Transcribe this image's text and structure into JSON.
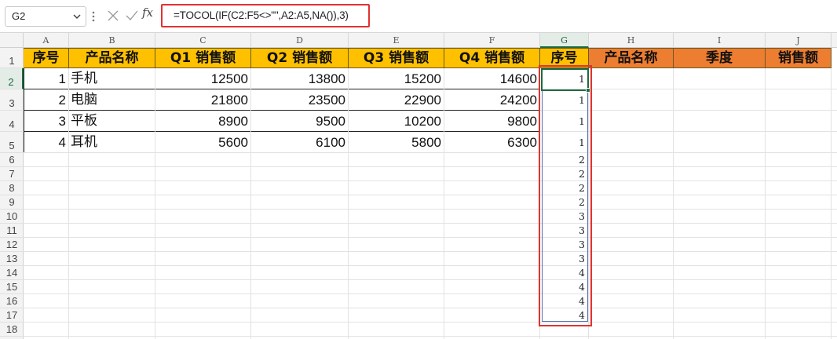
{
  "name_box": {
    "value": "G2"
  },
  "formula_bar": {
    "fx_label": "fx",
    "formula": "=TOCOL(IF(C2:F5<>\"\",A2:A5,NA()),3)"
  },
  "columns": [
    "A",
    "B",
    "C",
    "D",
    "E",
    "F",
    "G",
    "H",
    "I",
    "J"
  ],
  "selected_column": "G",
  "rows": [
    "1",
    "2",
    "3",
    "4",
    "5",
    "6",
    "7",
    "8",
    "9",
    "10",
    "11",
    "12",
    "13",
    "14",
    "15",
    "16",
    "17",
    "18"
  ],
  "selected_row": "2",
  "header_row": {
    "a": "序号",
    "b": "产品名称",
    "c": "Q1 销售额",
    "d": "Q2 销售额",
    "e": "Q3 销售额",
    "f": "Q4 销售额",
    "g": "序号",
    "h": "产品名称",
    "i": "季度",
    "j": "销售额"
  },
  "colors": {
    "header_yellow": "#ffc000",
    "header_orange": "#ed7d31",
    "highlight_red": "#e0322f",
    "selection_green": "#1e6b41"
  },
  "table": [
    {
      "id": "1",
      "product": "手机",
      "q1": "12500",
      "q2": "13800",
      "q3": "15200",
      "q4": "14600"
    },
    {
      "id": "2",
      "product": "电脑",
      "q1": "21800",
      "q2": "23500",
      "q3": "22900",
      "q4": "24200"
    },
    {
      "id": "3",
      "product": "平板",
      "q1": "8900",
      "q2": "9500",
      "q3": "10200",
      "q4": "9800"
    },
    {
      "id": "4",
      "product": "耳机",
      "q1": "5600",
      "q2": "6100",
      "q3": "5800",
      "q4": "6300"
    }
  ],
  "g_results": [
    "1",
    "1",
    "1",
    "1",
    "2",
    "2",
    "2",
    "2",
    "3",
    "3",
    "3",
    "3",
    "4",
    "4",
    "4",
    "4"
  ]
}
